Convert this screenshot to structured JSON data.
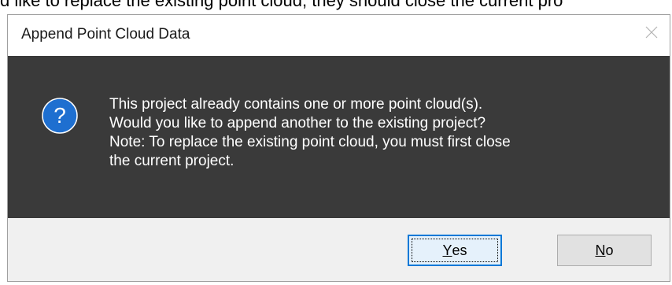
{
  "background_text": "d like to replace the existing point cloud, they should close the current pro",
  "dialog": {
    "title": "Append Point Cloud Data",
    "close_symbol": "×",
    "icon": "question-icon",
    "icon_glyph": "?",
    "message_lines": [
      "This project already contains one or more point cloud(s).",
      "Would you like to append another to the existing project?",
      "Note: To replace the existing point cloud, you must first close",
      "the current project."
    ],
    "buttons": {
      "yes": {
        "accel": "Y",
        "rest": "es"
      },
      "no": {
        "accel": "N",
        "rest": "o"
      }
    }
  },
  "colors": {
    "content_bg": "#3a3a3a",
    "footer_bg": "#f0f0f0",
    "icon_blue": "#1e6fd0",
    "default_button_border": "#0078d7"
  }
}
